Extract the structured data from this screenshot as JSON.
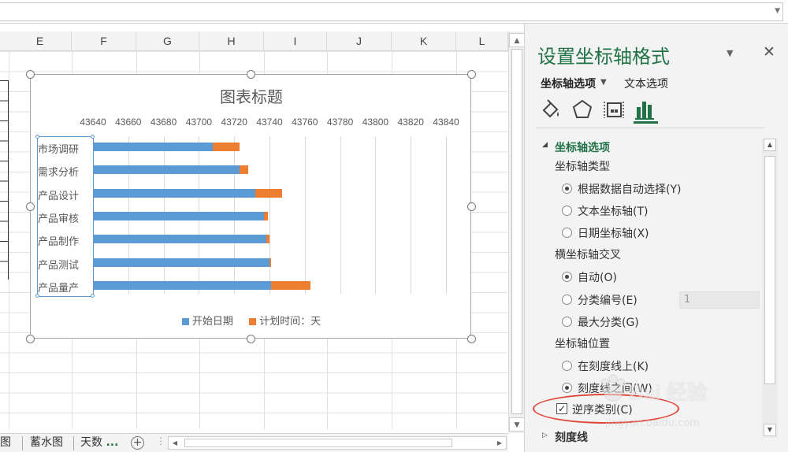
{
  "columns": [
    "E",
    "F",
    "G",
    "H",
    "I",
    "J",
    "K",
    "L"
  ],
  "chart": {
    "title": "图表标题"
  },
  "chart_data": {
    "type": "bar",
    "title": "图表标题",
    "categories": [
      "市场调研",
      "需求分析",
      "产品设计",
      "产品审核",
      "产品制作",
      "产品测试",
      "产品量产"
    ],
    "series": [
      {
        "name": "开始日期",
        "color": "#5b9bd5",
        "values": [
          43708,
          43723,
          43732,
          43737,
          43738,
          43740,
          43741
        ]
      },
      {
        "name": "计划时间：天",
        "color": "#ed7d31",
        "values": [
          15,
          5,
          15,
          2,
          2,
          1,
          22
        ]
      }
    ],
    "stacked": true,
    "orientation": "horizontal",
    "xticks": [
      "43640",
      "43660",
      "43680",
      "43700",
      "43720",
      "43740",
      "43760",
      "43780",
      "43800",
      "43820",
      "43840"
    ],
    "xlim": [
      43640,
      43840
    ],
    "grid": true,
    "legend_position": "bottom"
  },
  "sheet_tabs": {
    "tab1": "图",
    "tab2": "蓄水图",
    "tab3": "天数",
    "more": "..."
  },
  "pane": {
    "title": "设置坐标轴格式",
    "tab_axis_options": "坐标轴选项",
    "tab_text_options": "文本选项",
    "section_axis_options": "坐标轴选项",
    "axis_type_label": "坐标轴类型",
    "axis_type_options": [
      "根据数据自动选择(Y)",
      "文本坐标轴(T)",
      "日期坐标轴(X)"
    ],
    "cross_label": "横坐标轴交叉",
    "cross_options": [
      "自动(O)",
      "分类编号(E)",
      "最大分类(G)"
    ],
    "cross_value": "1",
    "position_label": "坐标轴位置",
    "position_options": [
      "在刻度线上(K)",
      "刻度线之间(W)"
    ],
    "reverse_label": "逆序类别(C)",
    "reverse_checked": "✓",
    "section_ticks": "刻度线"
  },
  "watermark": {
    "brand": "Bai 经验",
    "url": "jingyan.baidu.com"
  },
  "colors": {
    "accent": "#217346",
    "highlight": "#e0463a"
  }
}
